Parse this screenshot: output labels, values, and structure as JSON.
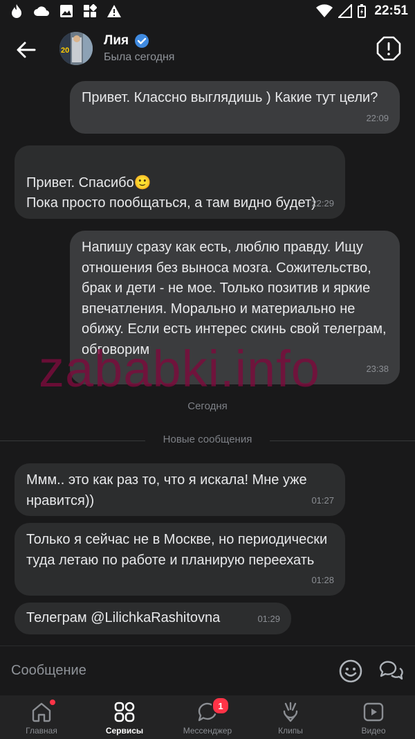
{
  "status_bar": {
    "time": "22:51"
  },
  "header": {
    "name": "Лия",
    "status": "Была сегодня"
  },
  "messages": [
    {
      "direction": "outgoing",
      "text": "Привет. Классно выглядишь ) Какие тут цели?",
      "time": "22:09"
    },
    {
      "direction": "incoming",
      "text": "Привет. Спасибо🙂\nПока просто пообщаться, а там видно будет)",
      "time": "22:29"
    },
    {
      "direction": "outgoing",
      "text": "Напишу сразу как есть, люблю правду. Ищу отношения без выноса мозга. Сожительство, брак и дети - не мое. Только позитив и яркие впечатления. Морально и материально не обижу. Если есть интерес скинь свой телеграм, обговорим",
      "time": "23:38"
    },
    {
      "direction": "incoming",
      "text": "Ммм.. это как раз то, что я искала! Мне уже нравится))",
      "time": "01:27"
    },
    {
      "direction": "incoming",
      "text": "Только я сейчас не в Москве, но периодически туда летаю по работе и планирую переехать",
      "time": "01:28"
    },
    {
      "direction": "incoming",
      "text": "Телеграм @LilichkaRashitovna",
      "time": "01:29"
    }
  ],
  "separators": {
    "date": "Сегодня",
    "new_messages": "Новые сообщения"
  },
  "watermark": "zababki.info",
  "composer": {
    "placeholder": "Сообщение"
  },
  "tabbar": {
    "items": [
      {
        "label": "Главная",
        "icon": "home-icon",
        "dot": true
      },
      {
        "label": "Сервисы",
        "icon": "services-icon",
        "active": true
      },
      {
        "label": "Мессенджер",
        "icon": "messenger-icon",
        "badge": "1"
      },
      {
        "label": "Клипы",
        "icon": "clips-icon"
      },
      {
        "label": "Видео",
        "icon": "video-icon"
      }
    ]
  },
  "colors": {
    "background": "#19191a",
    "incoming_bubble": "#2c2d2e",
    "outgoing_bubble": "#3b3c3e",
    "verified": "#3f8ae0",
    "badge": "#ff3347"
  }
}
